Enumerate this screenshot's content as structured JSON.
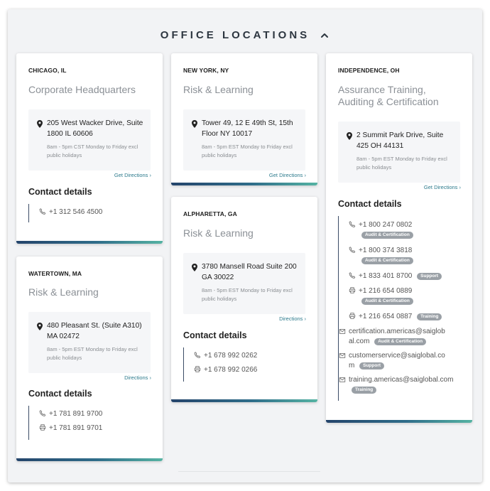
{
  "header": {
    "title": "OFFICE LOCATIONS"
  },
  "icons": {
    "collapse": "chevron-up-icon",
    "pin": "map-pin-icon",
    "phone": "phone-icon",
    "fax": "fax-icon",
    "email": "email-icon"
  },
  "colors": {
    "accent_start": "#24446b",
    "accent_end": "#55b3a3",
    "link": "#2c7a8c"
  },
  "contact_heading": "Contact details",
  "offices": {
    "chicago": {
      "city": "CHICAGO, IL",
      "name": "Corporate Headquarters",
      "address": "205 West Wacker Drive, Suite 1800 IL 60606",
      "hours": "8am - 5pm CST Monday to Friday excl public holidays",
      "directions": "Get Directions ›",
      "contacts": [
        {
          "value": "+1 312 546 4500"
        }
      ]
    },
    "watertown": {
      "city": "WATERTOWN, MA",
      "name": "Risk & Learning",
      "address": "480 Pleasant St. (Suite A310) MA 02472",
      "hours": "8am - 5pm EST Monday to Friday excl public holidays",
      "directions": "Directions ›",
      "contacts": [
        {
          "value": "+1 781 891 9700"
        },
        {
          "value": "+1 781 891 9701"
        }
      ]
    },
    "newyork": {
      "city": "NEW YORK, NY",
      "name": "Risk & Learning",
      "address": "Tower 49, 12 E 49th St, 15th Floor NY 10017",
      "hours": "8am - 5pm EST Monday to Friday excl public holidays",
      "directions": "Get Directions ›"
    },
    "alpharetta": {
      "city": "ALPHARETTA, GA",
      "name": "Risk & Learning",
      "address": "3780 Mansell Road Suite 200 GA 30022",
      "hours": "8am - 5pm EST Monday to Friday excl public holidays",
      "directions": "Directions ›",
      "contacts": [
        {
          "value": "+1 678 992 0262"
        },
        {
          "value": "+1 678 992 0266"
        }
      ]
    },
    "independence": {
      "city": "INDEPENDENCE, OH",
      "name": "Assurance Training, Auditing & Certification",
      "address": "2 Summit Park Drive, Suite 425 OH 44131",
      "hours": "8am - 5pm EST Monday to Friday excl public holidays",
      "directions": "Get Directions ›",
      "contacts": [
        {
          "value": "+1 800 247 0802",
          "badge": "Audit & Certification"
        },
        {
          "value": "+1 800 374 3818",
          "badge": "Audit & Certification"
        },
        {
          "value": "+1 833 401 8700",
          "badge": "Support"
        },
        {
          "value": "+1 216 654 0889",
          "badge": "Audit & Certification"
        },
        {
          "value": "+1 216 654 0887",
          "badge": "Training"
        },
        {
          "value": "certification.americas@saiglobal.com",
          "badge": "Audit & Certification"
        },
        {
          "value": "customerservice@saiglobal.com",
          "badge": "Support"
        },
        {
          "value": "training.americas@saiglobal.com",
          "badge": "Training"
        }
      ]
    }
  }
}
